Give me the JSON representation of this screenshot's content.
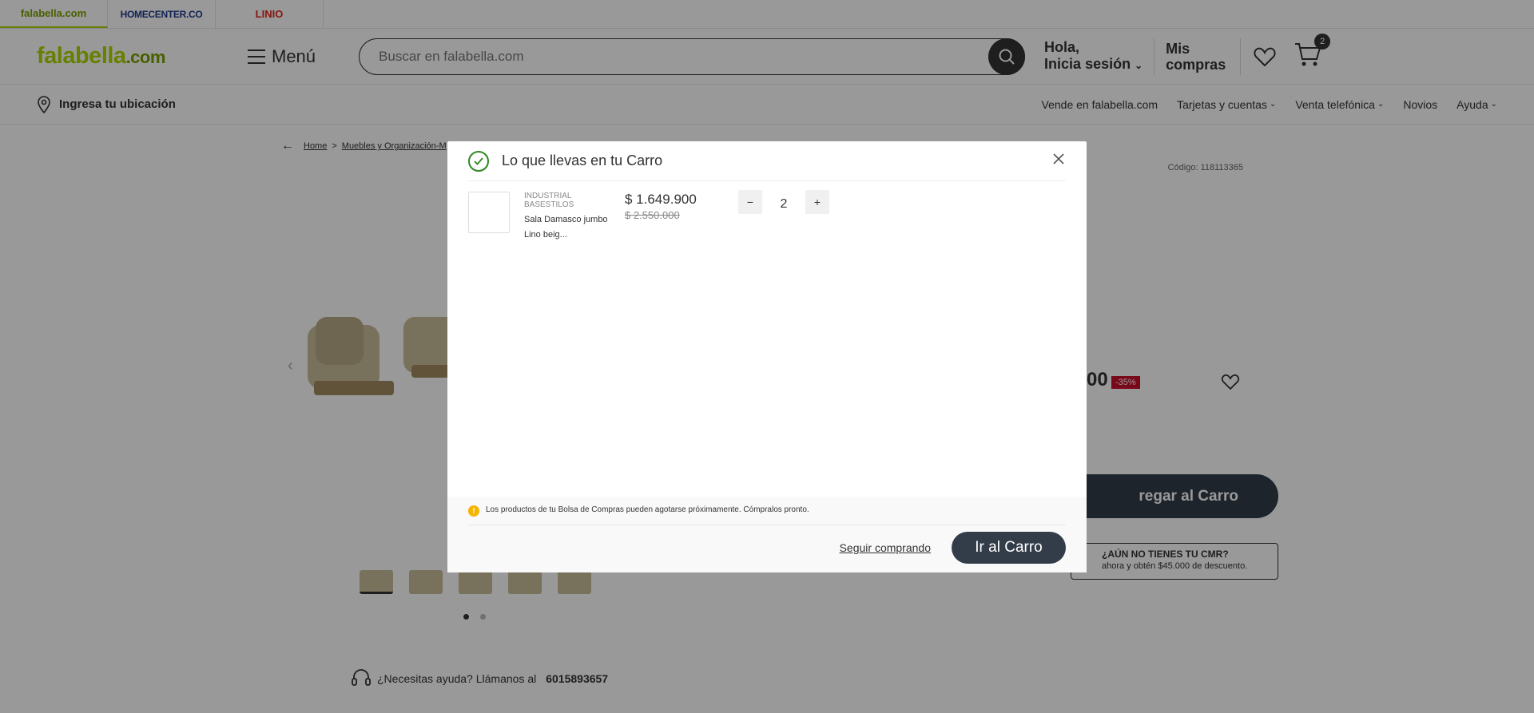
{
  "brands": [
    {
      "label": "falabella.com"
    },
    {
      "label": "HOMECENTER.CO"
    },
    {
      "label": "LINIO"
    }
  ],
  "header": {
    "logo": "falabella",
    "logo_suffix": ".com",
    "menu_label": "Menú",
    "search_placeholder": "Buscar en falabella.com",
    "greeting_line1": "Hola,",
    "greeting_line2": "Inicia sesión",
    "purchases_line1": "Mis",
    "purchases_line2": "compras",
    "cart_count": "2"
  },
  "subnav": {
    "location": "Ingresa tu ubicación",
    "links": [
      "Vende en falabella.com",
      "Tarjetas y cuentas",
      "Venta telefónica",
      "Novios",
      "Ayuda"
    ]
  },
  "page": {
    "breadcrumb_home": "Home",
    "breadcrumb_sep": ">",
    "breadcrumb_cat": "Muebles y Organización-M",
    "codigo": "Código: 118113365",
    "price_partial": "00",
    "discount": "-35%",
    "add_to_cart_partial": "regar al Carro",
    "cmr_title": "¿AÚN NO TIENES TU CMR?",
    "cmr_text": "ahora y obtén $45.000 de descuento.",
    "help_text": "¿Necesitas ayuda? Llámanos al",
    "help_phone": "6015893657"
  },
  "modal": {
    "title": "Lo que llevas en tu Carro",
    "item": {
      "brand": "INDUSTRIAL BASESTILOS",
      "name": "Sala Damasco jumbo Lino beig...",
      "price": "$ 1.649.900",
      "old_price": "$ 2.550.000",
      "quantity": "2",
      "minus": "−",
      "plus": "+"
    },
    "warning": "Los productos de tu Bolsa de Compras pueden agotarse próximamente. Cómpralos pronto.",
    "continue_label": "Seguir comprando",
    "go_cart_label": "Ir al Carro"
  },
  "colors": {
    "brand_green": "#aad500",
    "dark": "#333d4a",
    "discount_red": "#c8102e",
    "check_green": "#30871f"
  }
}
